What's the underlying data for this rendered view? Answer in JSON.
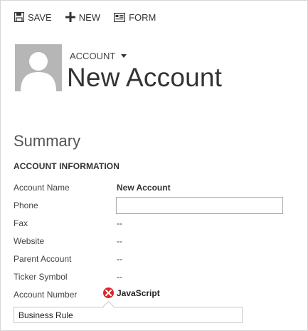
{
  "toolbar": {
    "save_label": "SAVE",
    "new_label": "NEW",
    "form_label": "FORM"
  },
  "header": {
    "entity_type": "ACCOUNT",
    "record_title": "New Account"
  },
  "summary": {
    "title": "Summary",
    "section_title": "ACCOUNT INFORMATION",
    "fields": [
      {
        "label": "Account Name",
        "value": "New Account"
      },
      {
        "label": "Phone",
        "value": ""
      },
      {
        "label": "Fax",
        "value": "--"
      },
      {
        "label": "Website",
        "value": "--"
      },
      {
        "label": "Parent Account",
        "value": "--"
      },
      {
        "label": "Ticker Symbol",
        "value": "--"
      },
      {
        "label": "Account Number",
        "value": ""
      }
    ]
  },
  "error": {
    "text": "JavaScript",
    "color": "#d9262b"
  },
  "business_rule": {
    "text": "Business Rule"
  }
}
